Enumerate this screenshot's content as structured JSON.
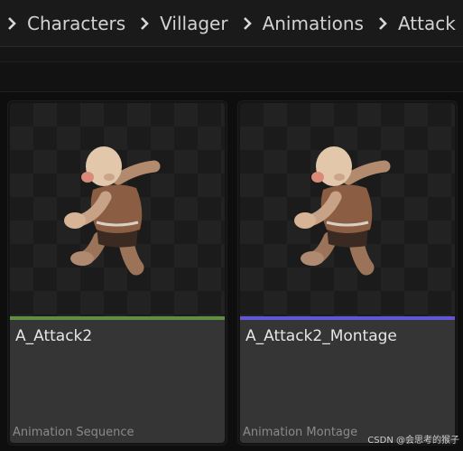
{
  "breadcrumb": {
    "items": [
      "Characters",
      "Villager",
      "Animations",
      "Attack"
    ]
  },
  "assets": [
    {
      "name": "A_Attack2",
      "type": "Animation Sequence",
      "type_color": "#5f8f43"
    },
    {
      "name": "A_Attack2_Montage",
      "type": "Animation Montage",
      "type_color": "#6157d6"
    }
  ],
  "watermark": "CSDN @会思考的猴子"
}
